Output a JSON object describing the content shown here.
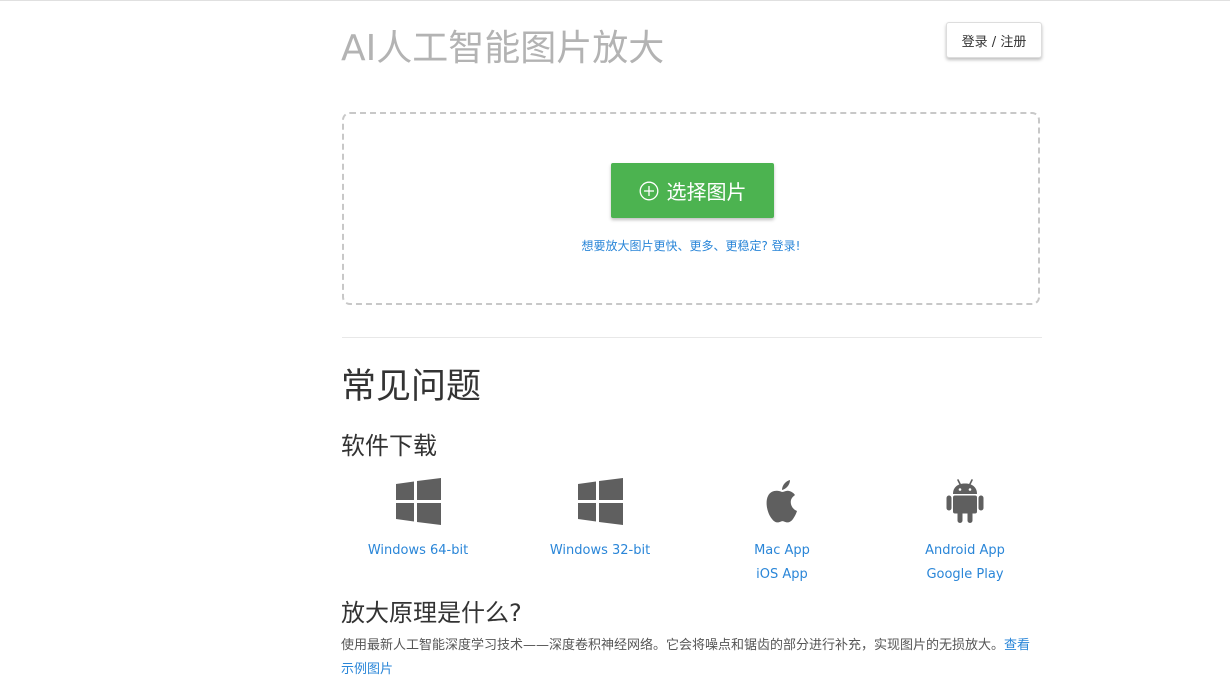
{
  "header": {
    "title": "AI人工智能图片放大",
    "login_label": "登录 / 注册"
  },
  "upload": {
    "select_label": "选择图片",
    "upgrade_text": "想要放大图片更快、更多、更稳定? 登录!"
  },
  "faq": {
    "title": "常见问题",
    "download_title": "软件下载",
    "downloads": [
      {
        "icon": "windows-icon",
        "links": [
          "Windows 64-bit"
        ]
      },
      {
        "icon": "windows-icon",
        "links": [
          "Windows 32-bit"
        ]
      },
      {
        "icon": "apple-icon",
        "links": [
          "Mac App",
          "iOS App"
        ]
      },
      {
        "icon": "android-icon",
        "links": [
          "Android App",
          "Google Play"
        ]
      }
    ],
    "principle_title": "放大原理是什么?",
    "principle_text": "使用最新人工智能深度学习技术——深度卷积神经网络。它会将噪点和锯齿的部分进行补充，实现图片的无损放大。",
    "example_link": "查看示例图片"
  },
  "colors": {
    "accent_green": "#4cb350",
    "link_blue": "#2a86d8",
    "title_gray": "#b3b3b3"
  }
}
